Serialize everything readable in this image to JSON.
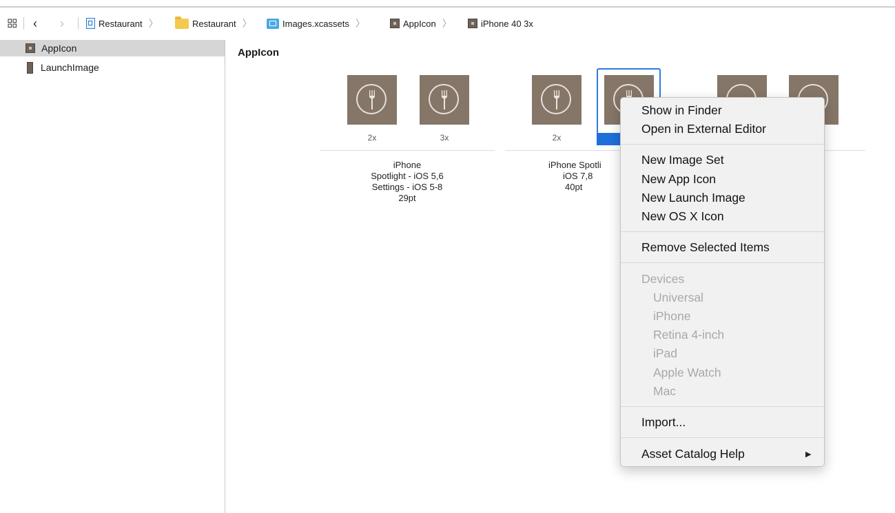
{
  "jumpbar": {
    "crumbs": [
      {
        "label": "Restaurant",
        "icon": "project-icon"
      },
      {
        "label": "Restaurant",
        "icon": "folder-icon"
      },
      {
        "label": "Images.xcassets",
        "icon": "asset-catalog-icon"
      },
      {
        "label": "AppIcon",
        "icon": "app-icon-set-icon"
      },
      {
        "label": "iPhone 40 3x",
        "icon": "app-icon-set-icon"
      }
    ]
  },
  "sidebar": {
    "items": [
      {
        "label": "AppIcon",
        "icon": "app-icon-set-icon",
        "selected": true
      },
      {
        "label": "LaunchImage",
        "icon": "launch-image-icon",
        "selected": false
      }
    ]
  },
  "content": {
    "title": "AppIcon",
    "groups": [
      {
        "scales": [
          "2x",
          "3x"
        ],
        "label_lines": [
          "iPhone",
          "Spotlight - iOS 5,6",
          "Settings - iOS 5-8",
          "29pt"
        ]
      },
      {
        "scales": [
          "2x",
          ""
        ],
        "label_lines": [
          "iPhone Spotli",
          "iOS 7,8",
          "40pt"
        ]
      }
    ]
  },
  "context_menu": {
    "sections": [
      [
        "Show in Finder",
        "Open in External Editor"
      ],
      [
        "New Image Set",
        "New App Icon",
        "New Launch Image",
        "New OS X Icon"
      ],
      [
        "Remove Selected Items"
      ]
    ],
    "devices_header": "Devices",
    "devices": [
      "Universal",
      "iPhone",
      "Retina 4-inch",
      "iPad",
      "Apple Watch",
      "Mac"
    ],
    "import": "Import...",
    "help": "Asset Catalog Help",
    "help_arrow": "▶"
  },
  "colors": {
    "accent": "#2d7be0",
    "icon_tile": "#857668",
    "disabled_text": "#a8a8a8"
  }
}
